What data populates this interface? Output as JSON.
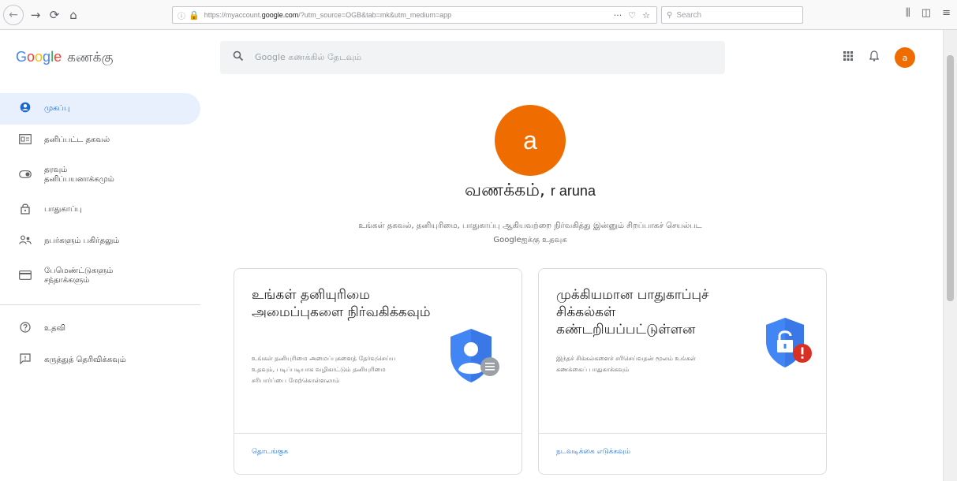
{
  "browser": {
    "url_prefix": "https://myaccount.",
    "url_domain": "google.com",
    "url_suffix": "/?utm_source=OGB&tab=mk&utm_medium=app",
    "more_icon": "ellipsis-icon",
    "search_placeholder": "Search"
  },
  "header": {
    "logo_letters": [
      "G",
      "o",
      "o",
      "g",
      "l",
      "e"
    ],
    "product_name": "கணக்கு",
    "search_placeholder": "Google கணக்கில் தேடவும்",
    "avatar_letter": "a"
  },
  "sidebar": {
    "items": [
      {
        "label": "முகப்பு",
        "icon": "account-circle-icon"
      },
      {
        "label": "தனிப்பட்ட தகவல்",
        "icon": "id-card-icon"
      },
      {
        "label1": "தரவும்",
        "label2": "தனிப்பயனாக்கமும்",
        "icon": "toggle-icon"
      },
      {
        "label": "பாதுகாப்பு",
        "icon": "lock-icon"
      },
      {
        "label": "நபர்களும் பகிர்தலும்",
        "icon": "people-icon"
      },
      {
        "label1": "பேமெண்ட்டுகளும்",
        "label2": "சந்தாக்களும்",
        "icon": "credit-card-icon"
      }
    ],
    "secondary": [
      {
        "label": "உதவி",
        "icon": "help-icon"
      },
      {
        "label": "கருத்துத் தெரிவிக்கவும்",
        "icon": "feedback-icon"
      }
    ]
  },
  "main": {
    "avatar_letter": "a",
    "greeting": "வணக்கம், ",
    "user_name": "r aruna",
    "subtext_line1": "உங்கள் தகவல், தனியுரிமை, பாதுகாப்பு ஆகியவற்றை நிர்வகித்து இன்னும் சிறப்பாகச் செயல்பட",
    "subtext_line2": "Googleஐக்கு உதவுக",
    "cards": [
      {
        "title": "உங்கள் தனியுரிமை அமைப்புகளை நிர்வகிக்கவும்",
        "description": "உங்கள் தனியுரிமை அமைப்புகளைத் தேர்வுசெய்ய உதவும், படிப்படியாக வழிகாட்டும் தனியுரிமை சரிபார்ப்பை மேற்கொள்ளலாம்",
        "link": "தொடங்குக",
        "illustration": "privacy-shield-icon"
      },
      {
        "title": "முக்கியமான பாதுகாப்புச் சிக்கல்கள் கண்டறியப்பட்டுள்ளன",
        "description": "இந்தச் சிக்கல்களைச் சரிசெய்வதன் மூலம் உங்கள் கணக்கைப் பாதுகாக்கவும்",
        "link": "நடவடிக்கை எடுக்கவும்",
        "illustration": "security-alert-shield-icon"
      }
    ]
  },
  "colors": {
    "avatar": "#ef6c00",
    "accent": "#1a73e8",
    "active_bg": "#e8f0fe",
    "shield_blue": "#4285f4",
    "alert_red": "#d93025"
  }
}
